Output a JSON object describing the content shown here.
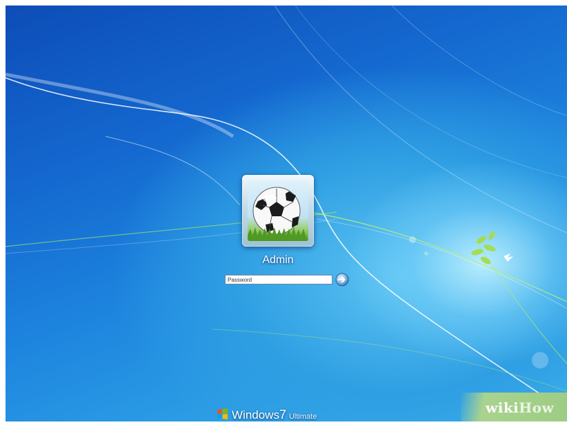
{
  "login": {
    "username": "Admin",
    "password_placeholder": "Password",
    "user_picture": "soccer-ball-icon",
    "submit_icon": "arrow-right-icon"
  },
  "branding": {
    "product": "Windows",
    "version": "7",
    "edition": "Ultimate",
    "logo_icon": "windows-flag-icon"
  },
  "watermark": {
    "part1": "wiki",
    "part2": "How"
  },
  "colors": {
    "background_dark": "#0d4db8",
    "background_light": "#46b8ee",
    "leaf_green": "#9bd84a",
    "watermark_green": "#9dcc84"
  }
}
